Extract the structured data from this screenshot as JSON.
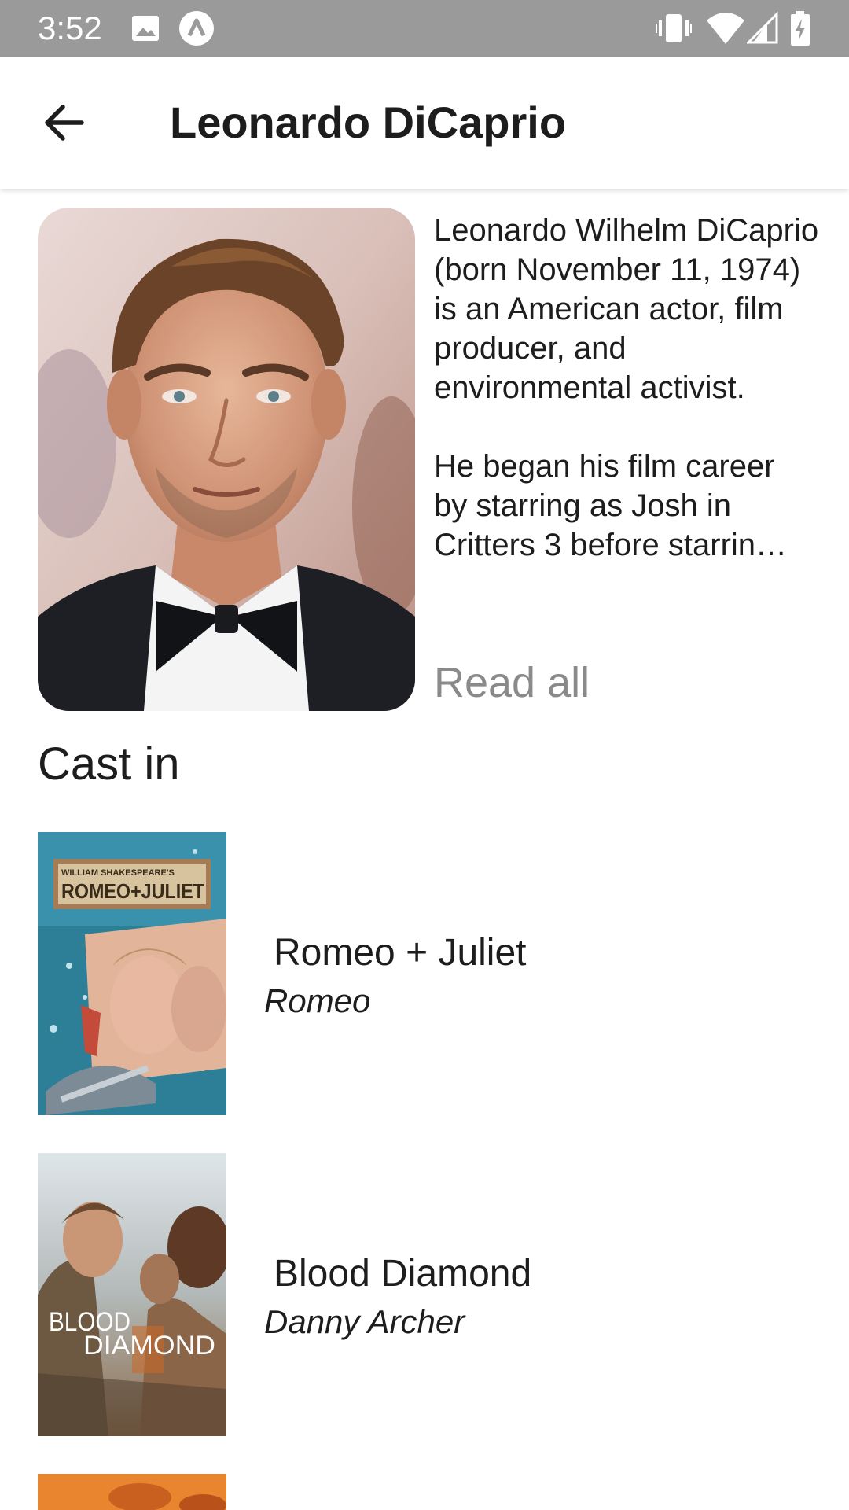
{
  "status_bar": {
    "time": "3:52",
    "icons": [
      "image-icon",
      "app-badge-icon",
      "vibrate-icon",
      "wifi-icon",
      "signal-icon",
      "battery-charging-icon"
    ]
  },
  "app_bar": {
    "back_icon": "arrow-back-icon",
    "title": "Leonardo DiCaprio"
  },
  "bio": {
    "paragraph1": "Leonardo Wilhelm DiCaprio (born November 11, 1974) is an American actor, film producer, and environmental activist.",
    "paragraph2_lines": [
      "He began his film career",
      "by starring as Josh in",
      "Critters 3 before starrin…"
    ],
    "read_all_label": "Read all"
  },
  "cast_section": {
    "title": "Cast in",
    "movies": [
      {
        "title": "Romeo + Juliet",
        "role": "Romeo",
        "poster_text_top": "WILLIAM SHAKESPEARE'S",
        "poster_text_main": "ROMEO+JULIET"
      },
      {
        "title": "Blood Diamond",
        "role": "Danny Archer",
        "poster_text_line1": "BLOOD",
        "poster_text_line2": "DIAMOND"
      }
    ]
  },
  "colors": {
    "status_bar": "#9a9a9a",
    "read_all": "#8a8a8a",
    "text": "#1d1d1d"
  }
}
